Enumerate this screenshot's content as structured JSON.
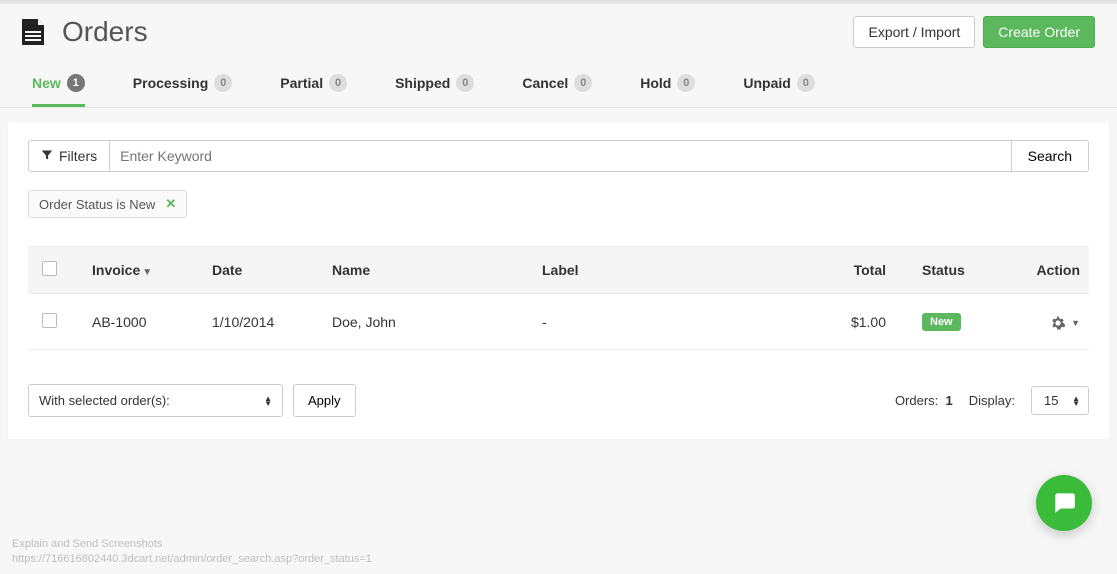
{
  "header": {
    "title": "Orders",
    "export_import_label": "Export / Import",
    "create_order_label": "Create Order"
  },
  "tabs": [
    {
      "id": "new",
      "label": "New",
      "count": "1",
      "active": true
    },
    {
      "id": "processing",
      "label": "Processing",
      "count": "0",
      "active": false
    },
    {
      "id": "partial",
      "label": "Partial",
      "count": "0",
      "active": false
    },
    {
      "id": "shipped",
      "label": "Shipped",
      "count": "0",
      "active": false
    },
    {
      "id": "cancel",
      "label": "Cancel",
      "count": "0",
      "active": false
    },
    {
      "id": "hold",
      "label": "Hold",
      "count": "0",
      "active": false
    },
    {
      "id": "unpaid",
      "label": "Unpaid",
      "count": "0",
      "active": false
    }
  ],
  "search": {
    "filters_label": "Filters",
    "placeholder": "Enter Keyword",
    "search_label": "Search"
  },
  "active_filter": {
    "label": "Order Status is New"
  },
  "table": {
    "headers": {
      "invoice": "Invoice",
      "date": "Date",
      "name": "Name",
      "label": "Label",
      "total": "Total",
      "status": "Status",
      "action": "Action"
    },
    "rows": [
      {
        "invoice": "AB-1000",
        "date": "1/10/2014",
        "name": "Doe, John",
        "label": "-",
        "total": "$1.00",
        "status": "New"
      }
    ]
  },
  "bulk": {
    "label": "With selected order(s):",
    "apply_label": "Apply"
  },
  "footer": {
    "orders_label": "Orders:",
    "orders_count": "1",
    "display_label": "Display:",
    "display_value": "15"
  },
  "page_footer": {
    "line1": "Explain and Send Screenshots",
    "line2": "https://716616802440.3dcart.net/admin/order_search.asp?order_status=1"
  }
}
